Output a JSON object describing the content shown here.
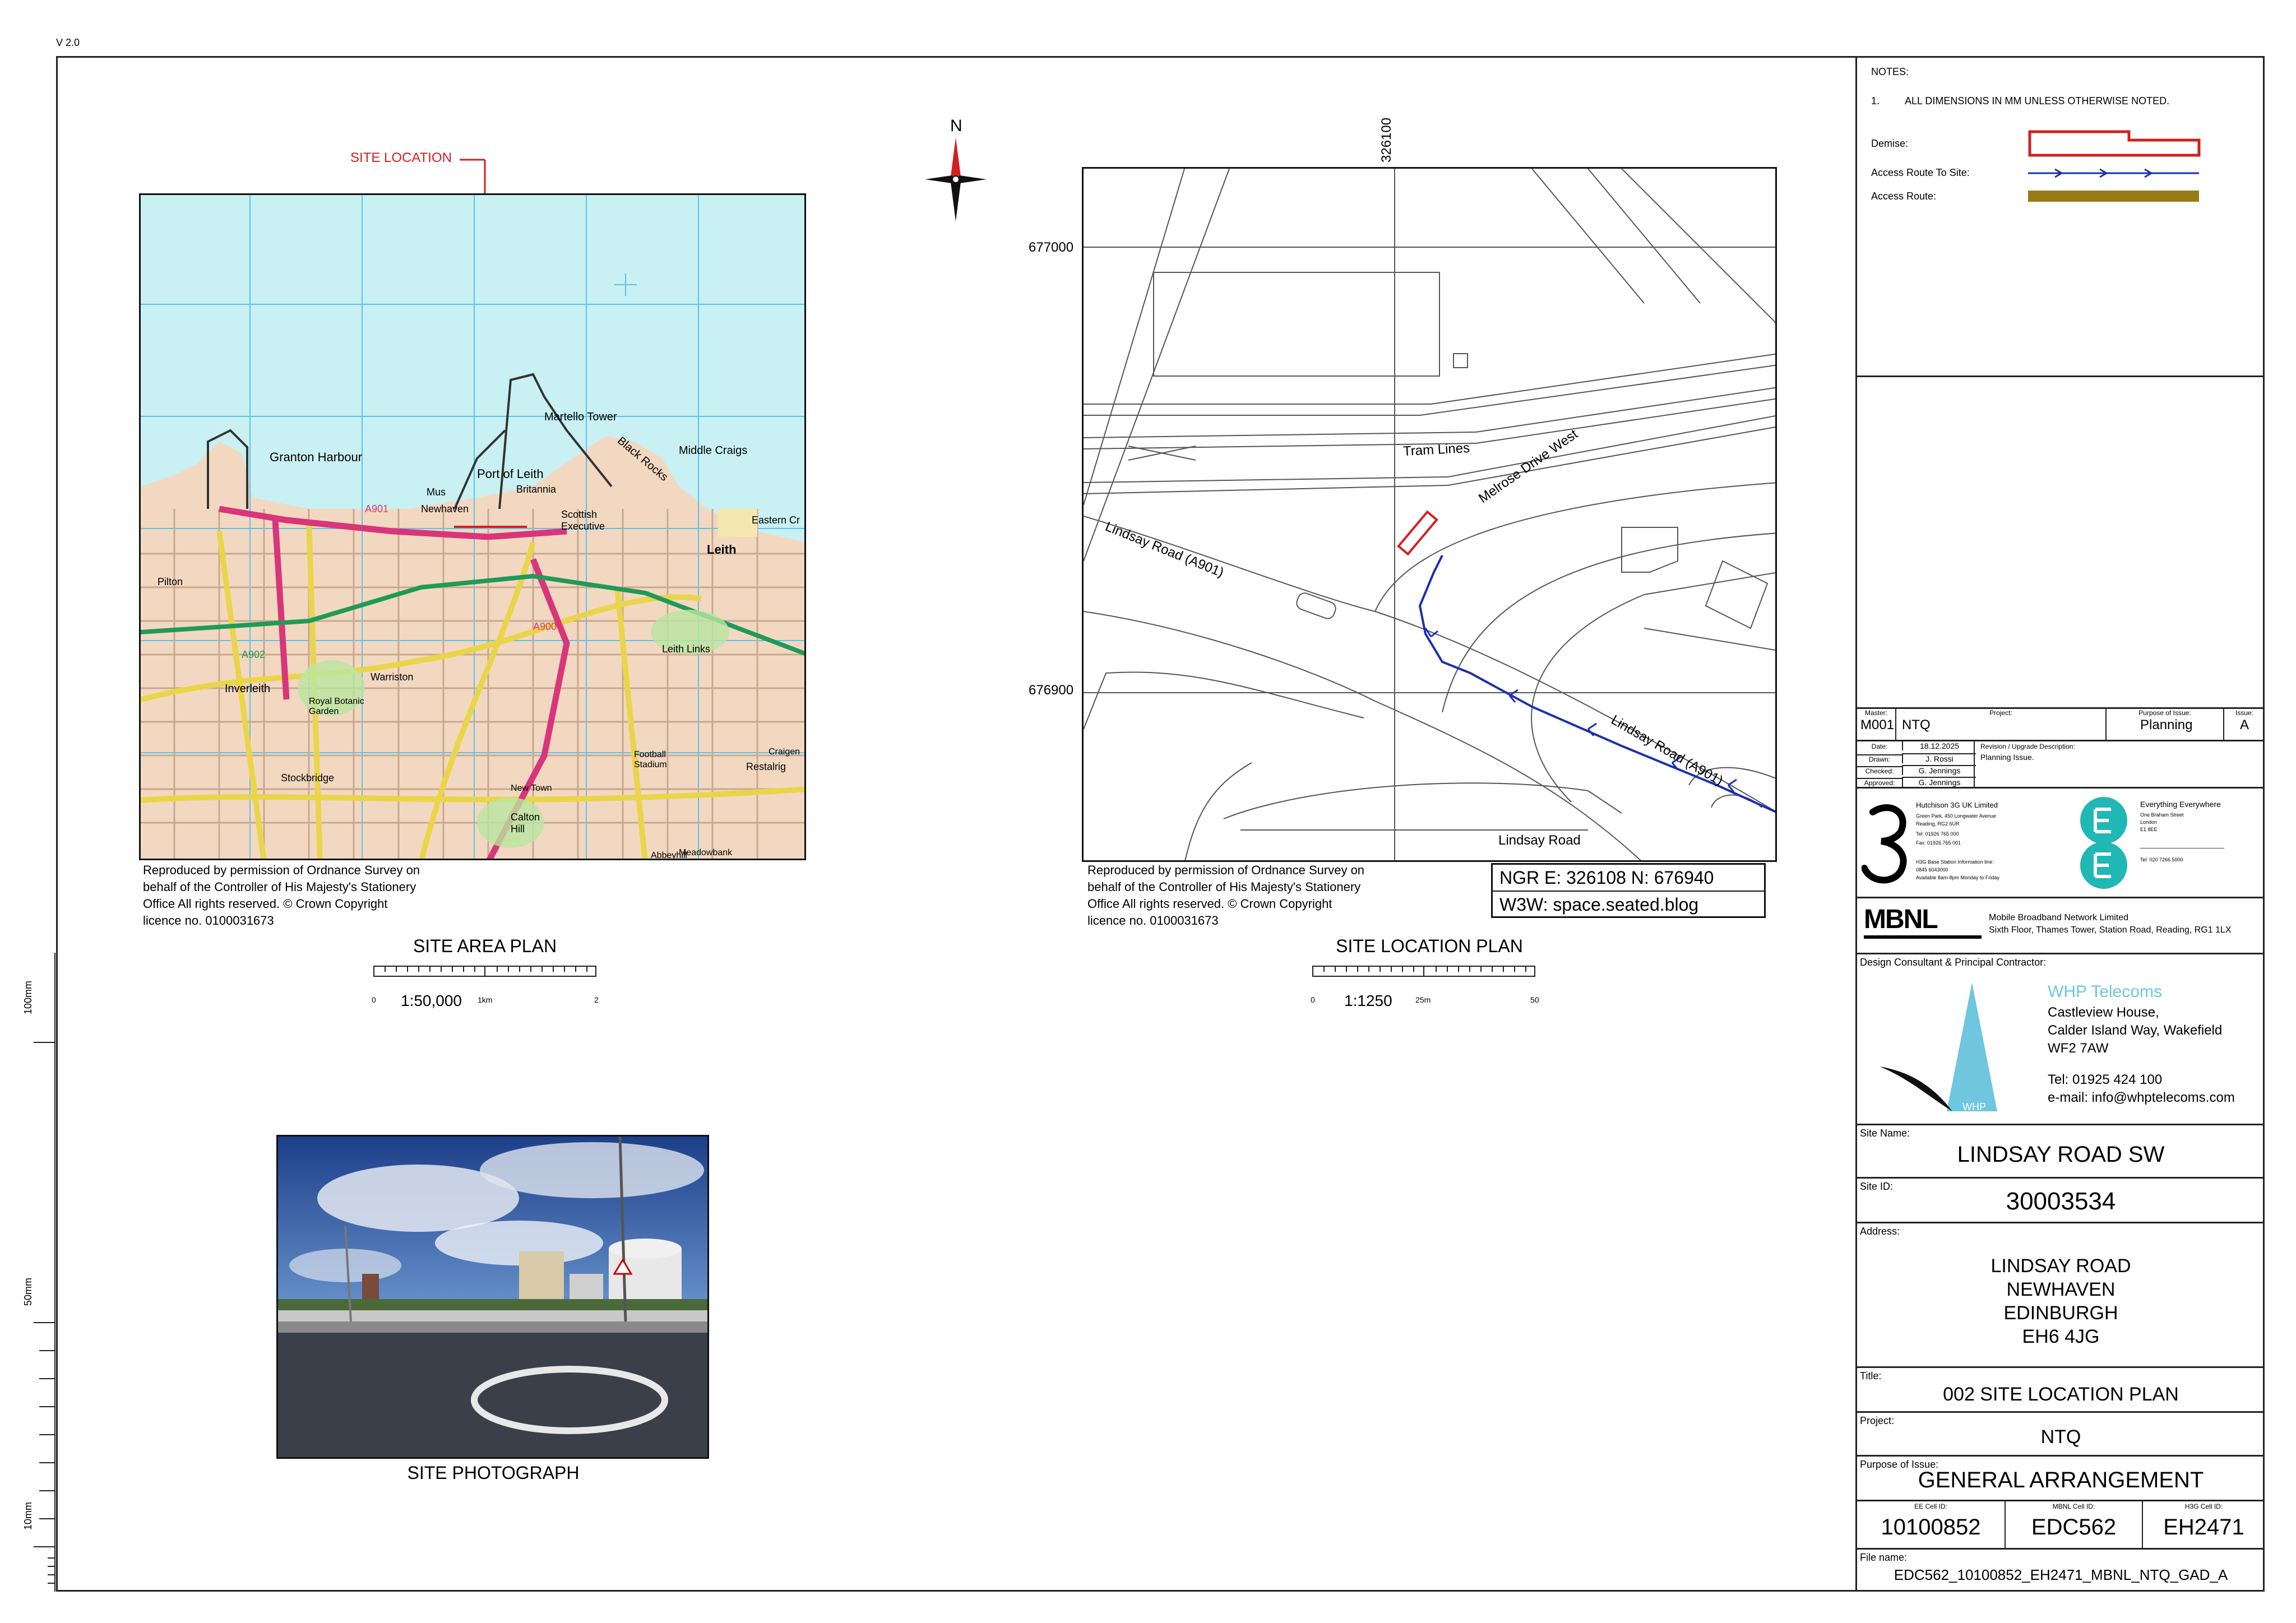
{
  "version": "V 2.0",
  "notes": {
    "heading": "NOTES:",
    "item_no": "1.",
    "item_text": "ALL DIMENSIONS IN MM UNLESS OTHERWISE NOTED.",
    "legend": [
      {
        "label": "Demise:",
        "color": "#d41f1f"
      },
      {
        "label": "Access Route To Site:",
        "color": "#1a2fb0"
      },
      {
        "label": "Access Route:",
        "color": "#9a7a17"
      }
    ]
  },
  "site_area_plan": {
    "site_location_label": "SITE LOCATION",
    "place_names": [
      "Martello Tower",
      "Middle Craigs",
      "Granton Harbour",
      "Port of Leith",
      "Black Rocks",
      "Britannia",
      "Newhaven",
      "Scottish Executive",
      "Leith",
      "Eastern Cr",
      "Mus",
      "Warriston",
      "Inverleith",
      "Royal Botanic Garden",
      "Stockbridge",
      "Pilton",
      "Football Stadium",
      "Leith Links",
      "Restalrig",
      "Craigen",
      "Abbeyhill",
      "Meadowbank",
      "Calton Hill",
      "New Town",
      "A902",
      "A901",
      "A900"
    ],
    "copyright": [
      "Reproduced by permission of Ordnance Survey on",
      "behalf of the Controller of His Majesty's Stationery",
      "Office All rights reserved. © Crown Copyright",
      "licence no. 0100031673"
    ],
    "title": "SITE AREA PLAN",
    "scale": "1:50,000",
    "ticks": [
      "0",
      "1km",
      "2"
    ]
  },
  "north": "N",
  "site_location_plan": {
    "grid_top": "326100",
    "grid_y1": "677000",
    "grid_y2": "676900",
    "labels": {
      "tram": "Tram Lines",
      "melrose": "Melrose Drive West",
      "lindsay1": "Lindsay Road (A901)",
      "lindsay2": "Lindsay Road (A901)",
      "lindsay3": "Lindsay Road"
    },
    "ngr": "NGR  E: 326108  N: 676940",
    "w3w": "W3W: space.seated.blog",
    "copyright": [
      "Reproduced by permission of Ordnance Survey on",
      "behalf of the Controller of His Majesty's Stationery",
      "Office All rights reserved. © Crown Copyright",
      "licence no. 0100031673"
    ],
    "title": "SITE LOCATION PLAN",
    "scale": "1:1250",
    "ticks": [
      "0",
      "25m",
      "50"
    ]
  },
  "photo": {
    "title": "SITE PHOTOGRAPH"
  },
  "ruler": {
    "marks": [
      "100mm",
      "50mm",
      "10mm"
    ]
  },
  "titleblock": {
    "master_label": "Master:",
    "master": "M001",
    "project_label": "Project:",
    "project": "NTQ",
    "purpose_label": "Purpose of Issue:",
    "purpose": "Planning",
    "issue_label": "Issue:",
    "issue": "A",
    "date_label": "Date:",
    "date": "18.12.2025",
    "drawn_label": "Drawn:",
    "drawn": "J. Rossi",
    "checked_label": "Checked:",
    "checked": "G. Jennings",
    "approved_label": "Approved:",
    "approved": "G. Jennings",
    "revision_label": "Revision / Upgrade Description:",
    "revision": "Planning Issue.",
    "h3g": {
      "name": "Hutchison 3G UK Limited",
      "addr1": "Green Park, 450 Longwater Avenue",
      "addr2": "Reading, RG2 6UR",
      "tel": "Tel: 01926 765 000",
      "fax": "Fax: 01926 765 001",
      "info1": "H3G Base Station Information line:",
      "info2": "0845 6043000",
      "info3": "Available 8am-8pm Monday to Friday"
    },
    "ee": {
      "name": "Everything Everywhere",
      "addr1": "One Braham Street",
      "addr2": "London",
      "addr3": "E1 8EE",
      "tel": "Tel: 020 7266 5000"
    },
    "mbnl": {
      "logo": "MBNL",
      "line1": "Mobile Broadband Network Limited",
      "line2": "Sixth Floor, Thames Tower,  Station Road, Reading, RG1 1LX"
    },
    "consultant_label": "Design Consultant & Principal Contractor:",
    "whp": {
      "name": "WHP Telecoms",
      "logo_text": "WHP",
      "addr1": "Castleview House,",
      "addr2": "Calder Island Way, Wakefield",
      "addr3": "WF2 7AW",
      "tel": "Tel: 01925 424 100",
      "email": "e-mail: info@whptelecoms.com"
    },
    "site_name_label": "Site Name:",
    "site_name": "LINDSAY ROAD SW",
    "site_id_label": "Site ID:",
    "site_id": "30003534",
    "address_label": "Address:",
    "address": [
      "LINDSAY ROAD",
      "NEWHAVEN",
      "EDINBURGH",
      "EH6 4JG"
    ],
    "title_label": "Title:",
    "title": "002 SITE LOCATION PLAN",
    "project2_label": "Project:",
    "project2": "NTQ",
    "purpose2_label": "Purpose of Issue:",
    "purpose2": "GENERAL ARRANGEMENT",
    "ee_cell_label": "EE Cell ID:",
    "ee_cell": "10100852",
    "mbnl_cell_label": "MBNL Cell ID:",
    "mbnl_cell": "EDC562",
    "h3g_cell_label": "H3G Cell ID:",
    "h3g_cell": "EH2471",
    "file_label": "File name:",
    "file": "EDC562_10100852_EH2471_MBNL_NTQ_GAD_A"
  }
}
